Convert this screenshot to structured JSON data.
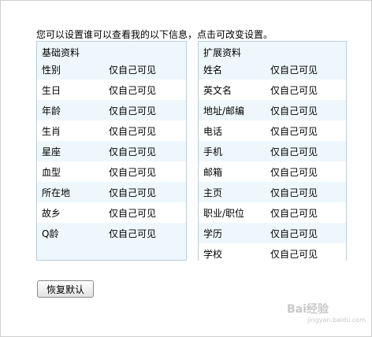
{
  "intro": "您可以设置谁可以查看我的以下信息，点击可改变设置。",
  "basic": {
    "title": "基础资料",
    "rows": [
      {
        "label": "性别",
        "value": "仅自己可见"
      },
      {
        "label": "生日",
        "value": "仅自己可见"
      },
      {
        "label": "年龄",
        "value": "仅自己可见"
      },
      {
        "label": "生肖",
        "value": "仅自己可见"
      },
      {
        "label": "星座",
        "value": "仅自己可见"
      },
      {
        "label": "血型",
        "value": "仅自己可见"
      },
      {
        "label": "所在地",
        "value": "仅自己可见"
      },
      {
        "label": "故乡",
        "value": "仅自己可见"
      },
      {
        "label": "Q龄",
        "value": "仅自己可见"
      }
    ]
  },
  "extended": {
    "title": "扩展资料",
    "rows": [
      {
        "label": "姓名",
        "value": "仅自己可见"
      },
      {
        "label": "英文名",
        "value": "仅自己可见"
      },
      {
        "label": "地址/邮编",
        "value": "仅自己可见"
      },
      {
        "label": "电话",
        "value": "仅自己可见"
      },
      {
        "label": "手机",
        "value": "仅自己可见"
      },
      {
        "label": "邮箱",
        "value": "仅自己可见"
      },
      {
        "label": "主页",
        "value": "仅自己可见"
      },
      {
        "label": "职业/职位",
        "value": "仅自己可见"
      },
      {
        "label": "学历",
        "value": "仅自己可见"
      },
      {
        "label": "学校",
        "value": "仅自己可见"
      }
    ]
  },
  "reset_label": "恢复默认",
  "watermark": {
    "logo": "Bai经验",
    "sub": "jingyan.baidu.com"
  },
  "colors": {
    "panel_bg": "#eef7fc",
    "panel_border": "#b9cfe0",
    "row_alt": "#ffffff"
  }
}
